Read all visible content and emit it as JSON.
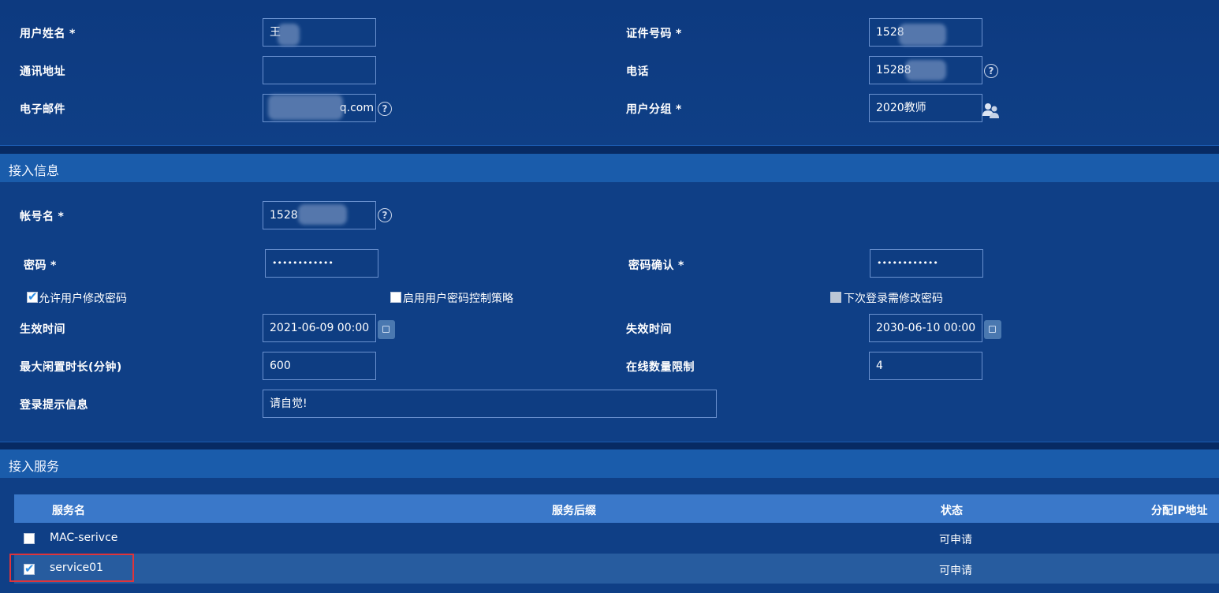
{
  "user_info": {
    "name_label": "用户姓名",
    "name_value": "王",
    "id_label": "证件号码",
    "id_value": "1528",
    "address_label": "通讯地址",
    "address_value": "",
    "phone_label": "电话",
    "phone_value": "15288",
    "email_label": "电子邮件",
    "email_value": "q.com",
    "group_label": "用户分组",
    "group_value": "2020教师",
    "required_mark": "*"
  },
  "access_info": {
    "title": "接入信息",
    "account_label": "帐号名",
    "account_value": "1528",
    "password_label": "密码",
    "password_value": "••••••••••••",
    "confirm_label": "密码确认",
    "confirm_value": "••••••••••••",
    "allow_change_label": "允许用户修改密码",
    "allow_change_checked": true,
    "enable_policy_label": "启用用户密码控制策略",
    "enable_policy_checked": false,
    "next_login_label": "下次登录需修改密码",
    "next_login_checked": false,
    "start_time_label": "生效时间",
    "start_time_value": "2021-06-09 00:00",
    "end_time_label": "失效时间",
    "end_time_value": "2030-06-10 00:00",
    "idle_label": "最大闲置时长(分钟)",
    "idle_value": "600",
    "online_limit_label": "在线数量限制",
    "online_limit_value": "4",
    "login_tip_label": "登录提示信息",
    "login_tip_value": "请自觉!"
  },
  "access_service": {
    "title": "接入服务",
    "columns": [
      "服务名",
      "服务后缀",
      "状态",
      "分配IP地址"
    ],
    "rows": [
      {
        "name": "MAC-serivce",
        "suffix": "",
        "status": "可申请",
        "checked": false
      },
      {
        "name": "service01",
        "suffix": "",
        "status": "可申请",
        "checked": true
      }
    ]
  },
  "colors": {
    "background": "#0d3a7e",
    "header": "#1a5cab",
    "table_header": "#3a78c9",
    "highlight": "#e0343a"
  },
  "icons": [
    "help-icon",
    "calendar-icon",
    "user-group-icon",
    "checkbox"
  ]
}
